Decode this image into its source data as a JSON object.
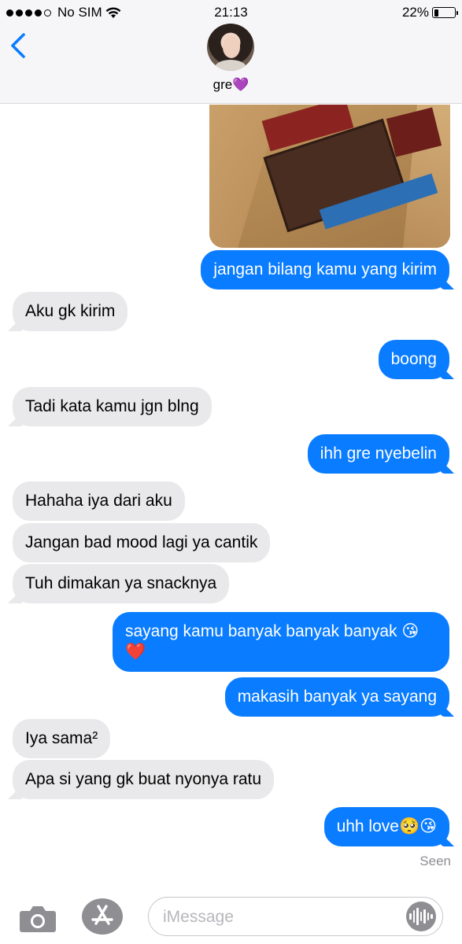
{
  "status_bar": {
    "carrier": "No SIM",
    "time": "21:13",
    "battery_percent": "22%",
    "battery_level": 0.22
  },
  "header": {
    "contact_name": "gre💜"
  },
  "conversation": {
    "messages": [
      {
        "direction": "outgoing",
        "text": "jangan bilang kamu yang kirim"
      },
      {
        "direction": "incoming",
        "text": "Aku gk kirim"
      },
      {
        "direction": "outgoing",
        "text": "boong"
      },
      {
        "direction": "incoming",
        "text": "Tadi kata kamu jgn blng"
      },
      {
        "direction": "outgoing",
        "text": "ihh gre nyebelin"
      },
      {
        "direction": "incoming",
        "text": "Hahaha iya dari aku"
      },
      {
        "direction": "incoming",
        "text": "Jangan bad mood lagi ya cantik"
      },
      {
        "direction": "incoming",
        "text": "Tuh dimakan ya snacknya"
      },
      {
        "direction": "outgoing",
        "text": "sayang kamu banyak banyak banyak 😘❤️"
      },
      {
        "direction": "outgoing",
        "text": "makasih banyak ya sayang"
      },
      {
        "direction": "incoming",
        "text": "Iya sama²"
      },
      {
        "direction": "incoming",
        "text": "Apa si yang gk buat nyonya ratu"
      },
      {
        "direction": "outgoing",
        "text": "uhh love🥺😘"
      }
    ],
    "read_receipt": "Seen"
  },
  "input_bar": {
    "placeholder": "iMessage"
  },
  "colors": {
    "outgoing_bubble": "#0a7cff",
    "incoming_bubble": "#e9e9eb",
    "accent": "#0a7cff"
  },
  "icons": [
    "signal-dots-icon",
    "wifi-icon",
    "battery-icon",
    "back-chevron-icon",
    "camera-icon",
    "app-store-icon",
    "voice-waveform-icon"
  ]
}
